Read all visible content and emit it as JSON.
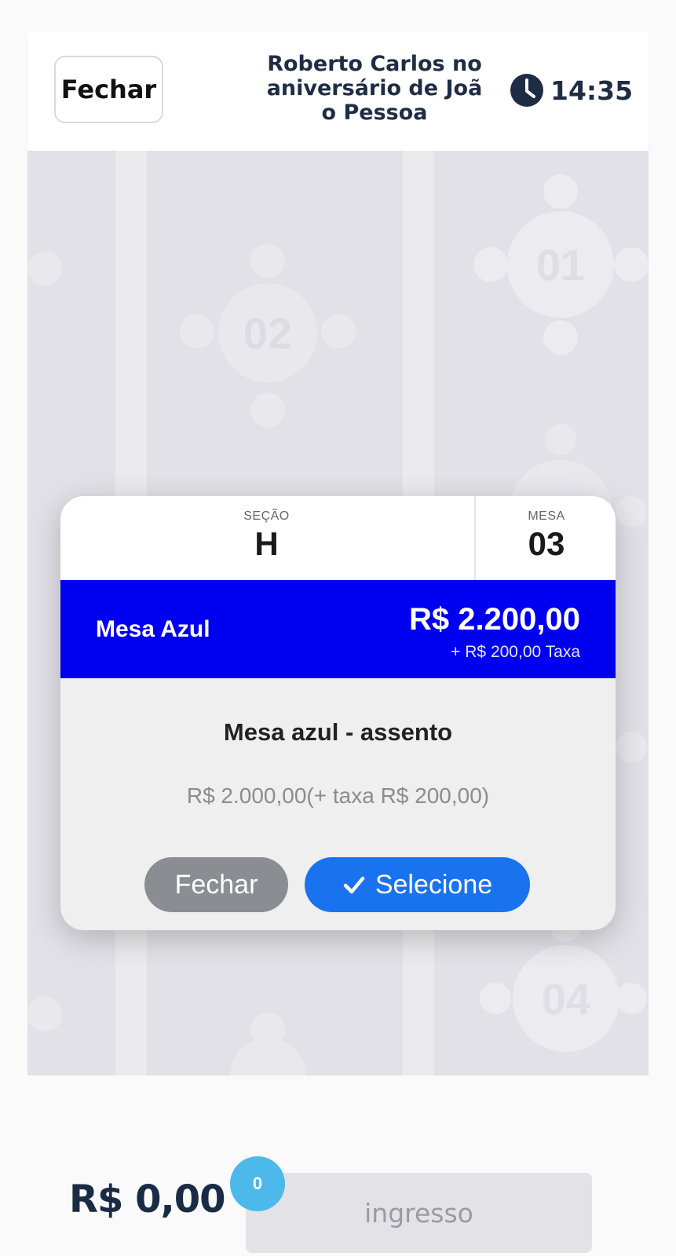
{
  "header": {
    "close_label": "Fechar",
    "event_title": "Roberto Carlos no aniversário de João Pessoa",
    "timer": "14:35",
    "timer_icon": "clock-icon"
  },
  "map": {
    "tables": [
      {
        "label": "01"
      },
      {
        "label": "02"
      },
      {
        "label": "04"
      }
    ]
  },
  "popup": {
    "section_label": "SEÇÃO",
    "section_value": "H",
    "table_label": "MESA",
    "table_value": "03",
    "band_name": "Mesa Azul",
    "band_price": "R$ 2.200,00",
    "band_fee": "+ R$ 200,00 Taxa",
    "band_color": "#0000f0",
    "ticket_name": "Mesa azul - assento",
    "ticket_price": "R$ 2.000,00(+ taxa R$ 200,00)",
    "close_label": "Fechar",
    "select_label": "Selecione",
    "select_icon": "checkmark-icon"
  },
  "footer": {
    "total": "R$ 0,00",
    "ticket_count": "0",
    "ticket_button_label": "ingresso"
  }
}
